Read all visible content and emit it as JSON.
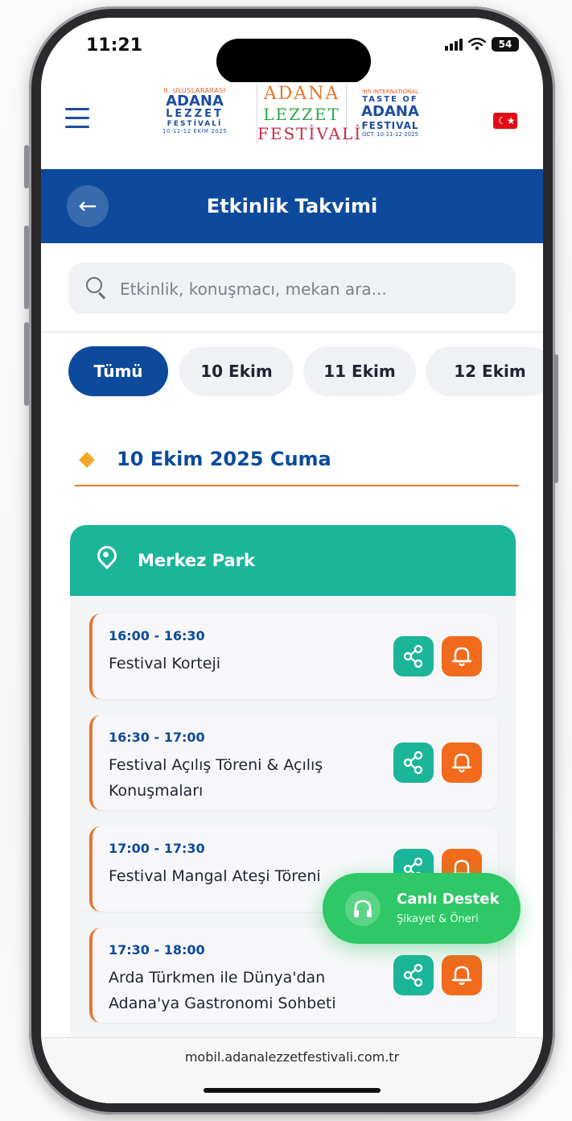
{
  "status": {
    "time": "11:21",
    "battery": "54"
  },
  "header": {
    "logo_left": {
      "small": "9. ULUSLARARASI",
      "big": "ADANA",
      "mid": "LEZZET",
      "sub": "FESTİVALİ",
      "date": "10-11-12 EKİM 2025"
    },
    "logo_center": {
      "line1": "ADANA",
      "line2": "LEZZET",
      "line3": "FESTİVALİ"
    },
    "logo_right": {
      "small": "9th INTERNATIONAL",
      "taste": "TASTE OF",
      "big": "ADANA",
      "mid": "FESTIVAL",
      "date": "OCT. 10-11-12 2025"
    }
  },
  "nav": {
    "title": "Etkinlik Takvimi"
  },
  "search": {
    "placeholder": "Etkinlik, konuşmacı, mekan ara..."
  },
  "tabs": [
    {
      "label": "Tümü",
      "active": true
    },
    {
      "label": "10 Ekim"
    },
    {
      "label": "11 Ekim"
    },
    {
      "label": "12 Ekim"
    }
  ],
  "day": {
    "title": "10 Ekim 2025 Cuma"
  },
  "venue": {
    "name": "Merkez Park"
  },
  "events": [
    {
      "time": "16:00 - 16:30",
      "title": "Festival Korteji"
    },
    {
      "time": "16:30 - 17:00",
      "title": "Festival Açılış Töreni & Açılış Konuşmaları"
    },
    {
      "time": "17:00 - 17:30",
      "title": "Festival Mangal Ateşi Töreni"
    },
    {
      "time": "17:30 - 18:00",
      "title": "Arda Türkmen ile Dünya'dan Adana'ya Gastronomi Sohbeti"
    }
  ],
  "support": {
    "title": "Canlı Destek",
    "subtitle": "Şikayet & Öneri"
  },
  "browser": {
    "url": "mobil.adanalezzetfestivali.com.tr"
  },
  "colors": {
    "primary": "#0d4a9c",
    "teal": "#1bb59a",
    "orange": "#f26a1b",
    "accent": "#e8752b",
    "green": "#2ec866"
  }
}
